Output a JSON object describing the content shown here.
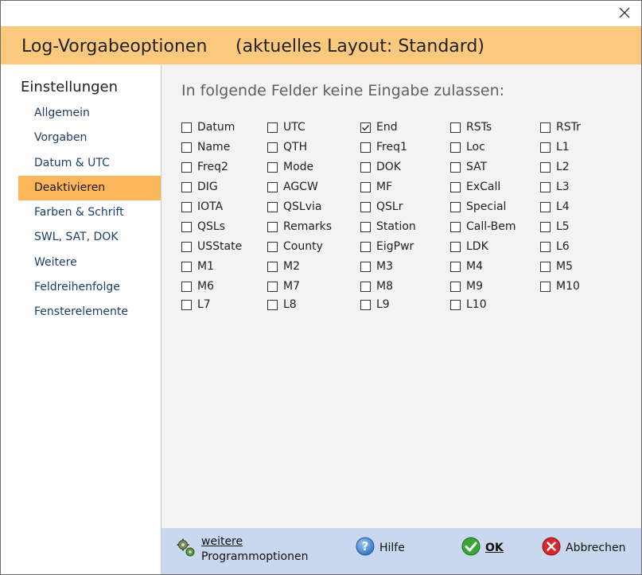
{
  "dialog": {
    "title": "Log-Vorgabeoptionen",
    "layout_label": "(aktuelles Layout: Standard)"
  },
  "sidebar": {
    "heading": "Einstellungen",
    "items": [
      {
        "label": "Allgemein"
      },
      {
        "label": "Vorgaben"
      },
      {
        "label": "Datum & UTC"
      },
      {
        "label": "Deaktivieren",
        "active": true
      },
      {
        "label": "Farben & Schrift"
      },
      {
        "label": "SWL, SAT, DOK"
      },
      {
        "label": "Weitere"
      },
      {
        "label": "Feldreihenfolge"
      },
      {
        "label": "Fensterelemente"
      }
    ]
  },
  "main": {
    "prompt": "In folgende Felder keine Eingabe zulassen:",
    "fields": [
      {
        "label": "Datum",
        "checked": false
      },
      {
        "label": "UTC",
        "checked": false
      },
      {
        "label": "End",
        "checked": true
      },
      {
        "label": "RSTs",
        "checked": false
      },
      {
        "label": "RSTr",
        "checked": false
      },
      {
        "label": "Name",
        "checked": false
      },
      {
        "label": "QTH",
        "checked": false
      },
      {
        "label": "Freq1",
        "checked": false
      },
      {
        "label": "Loc",
        "checked": false
      },
      {
        "label": "L1",
        "checked": false
      },
      {
        "label": "Freq2",
        "checked": false
      },
      {
        "label": "Mode",
        "checked": false
      },
      {
        "label": "DOK",
        "checked": false
      },
      {
        "label": "SAT",
        "checked": false
      },
      {
        "label": "L2",
        "checked": false
      },
      {
        "label": "DIG",
        "checked": false
      },
      {
        "label": "AGCW",
        "checked": false
      },
      {
        "label": "MF",
        "checked": false
      },
      {
        "label": "ExCall",
        "checked": false
      },
      {
        "label": "L3",
        "checked": false
      },
      {
        "label": "IOTA",
        "checked": false
      },
      {
        "label": "QSLvia",
        "checked": false
      },
      {
        "label": "QSLr",
        "checked": false
      },
      {
        "label": "Special",
        "checked": false
      },
      {
        "label": "L4",
        "checked": false
      },
      {
        "label": "QSLs",
        "checked": false
      },
      {
        "label": "Remarks",
        "checked": false
      },
      {
        "label": "Station",
        "checked": false
      },
      {
        "label": "Call-Bem",
        "checked": false
      },
      {
        "label": "L5",
        "checked": false
      },
      {
        "label": "USState",
        "checked": false
      },
      {
        "label": "County",
        "checked": false
      },
      {
        "label": "EigPwr",
        "checked": false
      },
      {
        "label": "LDK",
        "checked": false
      },
      {
        "label": "L6",
        "checked": false
      },
      {
        "label": "M1",
        "checked": false
      },
      {
        "label": "M2",
        "checked": false
      },
      {
        "label": "M3",
        "checked": false
      },
      {
        "label": "M4",
        "checked": false
      },
      {
        "label": "M5",
        "checked": false
      },
      {
        "label": "M6",
        "checked": false
      },
      {
        "label": "M7",
        "checked": false
      },
      {
        "label": "M8",
        "checked": false
      },
      {
        "label": "M9",
        "checked": false
      },
      {
        "label": "M10",
        "checked": false
      },
      {
        "label": "L7",
        "checked": false
      },
      {
        "label": "L8",
        "checked": false
      },
      {
        "label": "L9",
        "checked": false
      },
      {
        "label": "L10",
        "checked": false
      }
    ]
  },
  "footer": {
    "more_options_line1": "weitere",
    "more_options_line2": "Programmoptionen",
    "help_label": "Hilfe",
    "ok_label": "OK",
    "cancel_label": "Abbrechen"
  },
  "icons": {
    "close": "close-icon",
    "more_options": "gears-icon",
    "help": "help-icon",
    "ok": "check-icon",
    "cancel": "cancel-icon"
  },
  "colors": {
    "header_bg": "#fbc97e",
    "active_nav_bg": "#fbb65a",
    "content_bg": "#f3f3f3",
    "footer_bg": "#c9d7ef",
    "nav_text": "#1d3d6b"
  }
}
